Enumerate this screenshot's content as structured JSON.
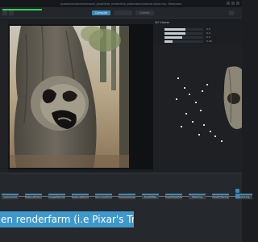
{
  "window": {
    "title": "/quaternion/dev/meshroom_graph/tree_renderfarm_submission/reconstruction.mg - Meshroom"
  },
  "toolbar": {
    "progress": 1.0,
    "tabs": [
      {
        "label": "Compute",
        "active": true
      },
      {
        "label": "",
        "active": false
      },
      {
        "label": "Submit",
        "active": false
      }
    ]
  },
  "panel3d": {
    "title": "3D Viewer",
    "params": [
      {
        "value": "0.0",
        "level": 0.55
      },
      {
        "value": "0.0",
        "level": 0.55
      },
      {
        "value": "0.0",
        "level": 0.45
      },
      {
        "value": "0.00",
        "level": 0.2
      }
    ]
  },
  "graph": {
    "nodes": [
      "CameraInit",
      "FeatureExtraction",
      "ImageMatching",
      "FeatureMatching",
      "StructureFromMotion",
      "PrepareDenseScene",
      "DepthMap",
      "DepthMapFilter",
      "Meshing",
      "MeshFiltering",
      "Texturing"
    ]
  },
  "caption": {
    "text": "en renderfarm (i.e Pixar's Tractor)"
  },
  "colors": {
    "accent": "#3a8ab8",
    "caption_bg": "#3f98cc",
    "progress": "#2ed158"
  }
}
